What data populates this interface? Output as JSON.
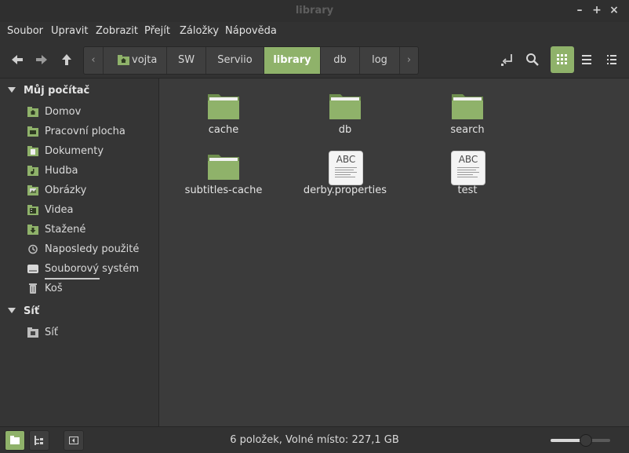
{
  "window": {
    "title": "library"
  },
  "menu": [
    "Soubor",
    "Upravit",
    "Zobrazit",
    "Přejít",
    "Záložky",
    "Nápověda"
  ],
  "breadcrumbs": [
    "vojta",
    "SW",
    "Serviio",
    "library",
    "db",
    "log"
  ],
  "sidebar": {
    "sections": [
      {
        "title": "Můj počítač",
        "items": [
          "Domov",
          "Pracovní plocha",
          "Dokumenty",
          "Hudba",
          "Obrázky",
          "Videa",
          "Stažené",
          "Naposledy použité",
          "Souborový systém",
          "Koš"
        ]
      },
      {
        "title": "Síť",
        "items": [
          "Síť"
        ]
      }
    ]
  },
  "files": [
    {
      "name": "cache",
      "kind": "folder"
    },
    {
      "name": "db",
      "kind": "folder"
    },
    {
      "name": "search",
      "kind": "folder"
    },
    {
      "name": "subtitles-cache",
      "kind": "folder"
    },
    {
      "name": "derby.properties",
      "kind": "text"
    },
    {
      "name": "test",
      "kind": "text"
    }
  ],
  "doc_icon_text": "ABC",
  "status": {
    "text": "6 položek, Volné místo: 227,1 GB",
    "zoom_level": 0.58
  },
  "colors": {
    "accent": "#8fb26a",
    "folder": "#8fb26a"
  }
}
